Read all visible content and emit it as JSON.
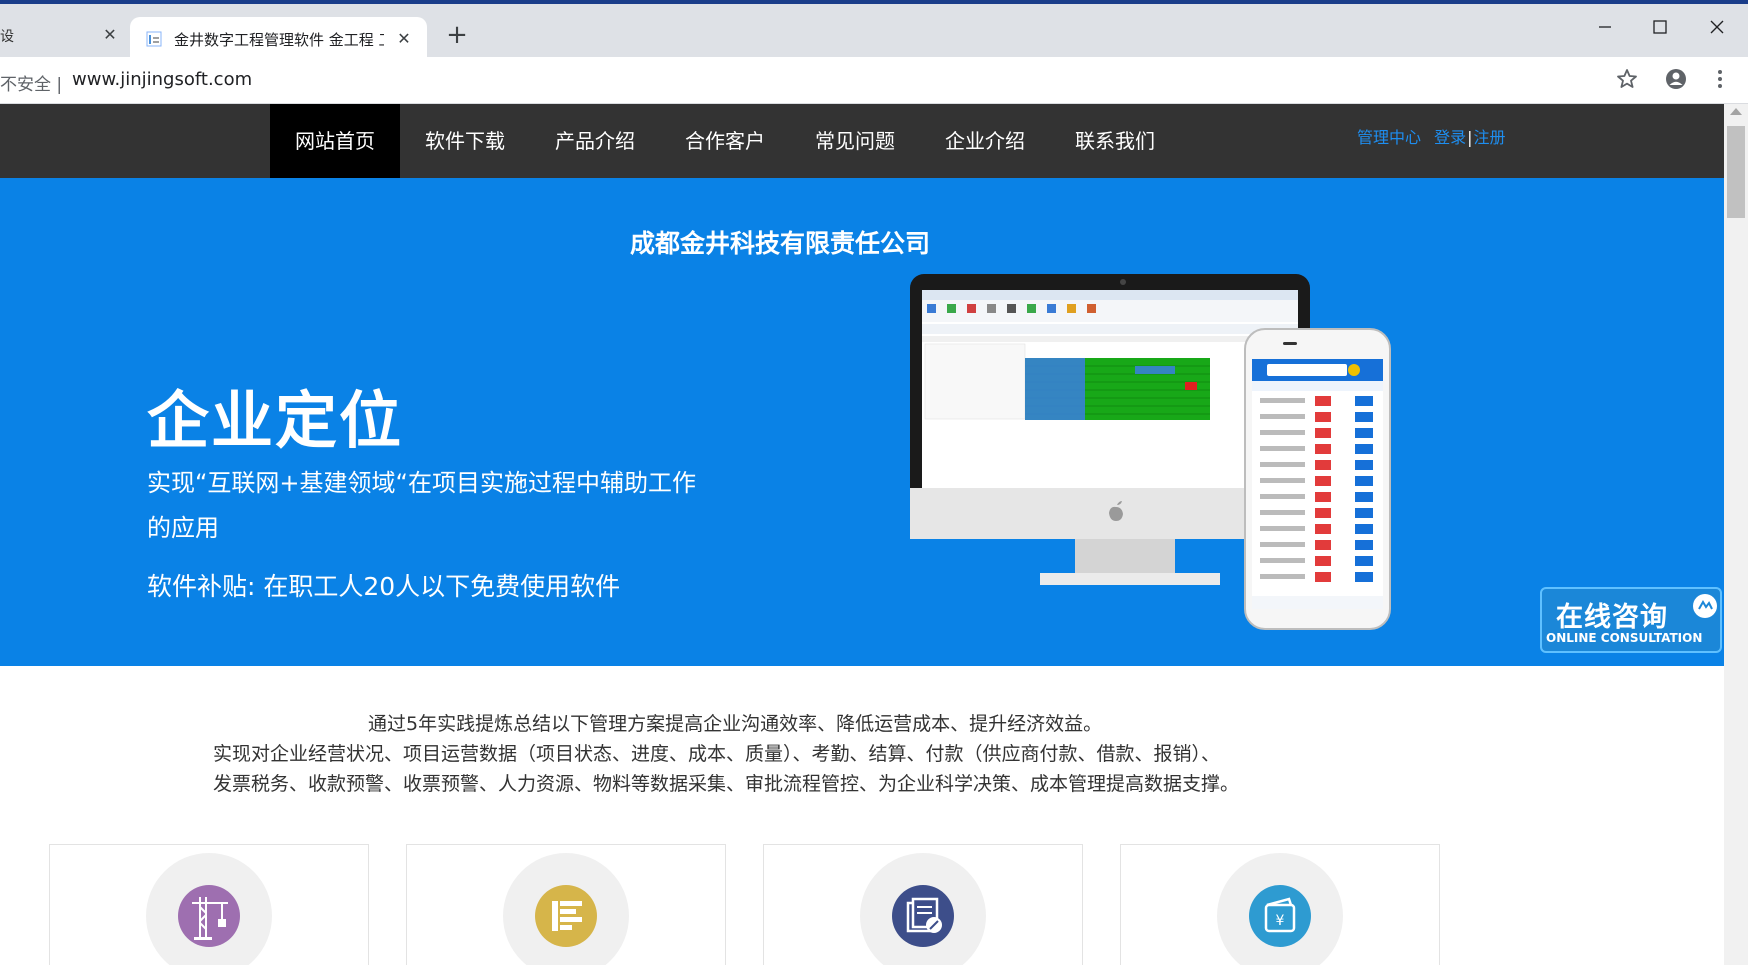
{
  "browser": {
    "prev_tab_fragment": "设",
    "active_tab_title": "金井数字工程管理软件 金工程 工",
    "security_label": "不安全 |",
    "url": "www.jinjingsoft.com"
  },
  "nav": {
    "items": [
      {
        "label": "网站首页",
        "active": true
      },
      {
        "label": "软件下载",
        "active": false
      },
      {
        "label": "产品介绍",
        "active": false
      },
      {
        "label": "合作客户",
        "active": false
      },
      {
        "label": "常见问题",
        "active": false
      },
      {
        "label": "企业介绍",
        "active": false
      },
      {
        "label": "联系我们",
        "active": false
      }
    ],
    "admin_center": "管理中心",
    "login": "登录",
    "separator": "|",
    "register": "注册"
  },
  "hero": {
    "company": "成都金井科技有限责任公司",
    "title": "企业定位",
    "description": "实现“互联网+基建领域“在项目实施过程中辅助工作的应用",
    "subsidy": "软件补贴: 在职工人20人以下免费使用软件"
  },
  "consult": {
    "title": "在线咨询",
    "subtitle": "ONLINE CONSULTATION"
  },
  "intro": {
    "line1": "通过5年实践提炼总结以下管理方案提高企业沟通效率、降低运营成本、提升经济效益。",
    "line2": "实现对企业经营状况、项目运营数据（项目状态、进度、成本、质量）、考勤、结算、付款（供应商付款、借款、报销）、",
    "line3": "发票税务、收款预警、收票预警、人力资源、物料等数据采集、审批流程管控、为企业科学决策、成本管理提高数据支撑。"
  },
  "features": [
    {
      "icon": "crane-icon",
      "color": "#9e6fb0"
    },
    {
      "icon": "list-doc-icon",
      "color": "#d6b54a"
    },
    {
      "icon": "documents-edit-icon",
      "color": "#3d4e8a"
    },
    {
      "icon": "wallet-yuan-icon",
      "color": "#2e9bd1"
    }
  ],
  "colors": {
    "hero_bg": "#0a82e6",
    "nav_bg": "#333333",
    "nav_active": "#000000",
    "link": "#1e8ef0"
  }
}
